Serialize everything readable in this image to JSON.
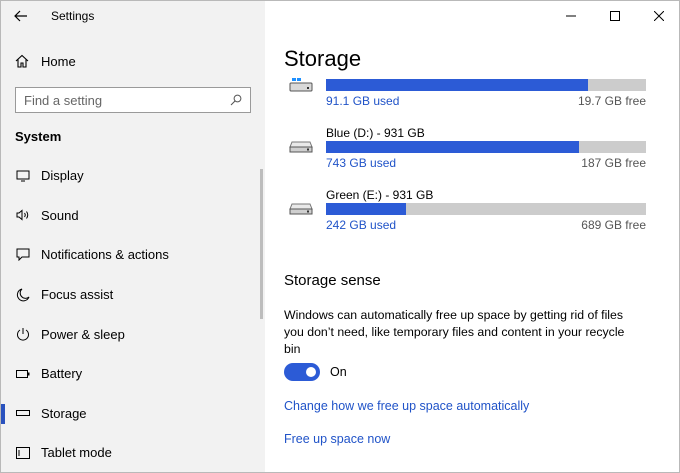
{
  "app": {
    "title": "Settings"
  },
  "sidebar": {
    "home_label": "Home",
    "search_placeholder": "Find a setting",
    "section_title": "System",
    "items": [
      {
        "label": "Display",
        "icon": "display-icon",
        "active": false
      },
      {
        "label": "Sound",
        "icon": "sound-icon",
        "active": false
      },
      {
        "label": "Notifications & actions",
        "icon": "notifications-icon",
        "active": false
      },
      {
        "label": "Focus assist",
        "icon": "moon-icon",
        "active": false
      },
      {
        "label": "Power & sleep",
        "icon": "power-icon",
        "active": false
      },
      {
        "label": "Battery",
        "icon": "battery-icon",
        "active": false
      },
      {
        "label": "Storage",
        "icon": "storage-icon",
        "active": true
      },
      {
        "label": "Tablet mode",
        "icon": "tablet-icon",
        "active": false
      }
    ]
  },
  "main": {
    "title": "Storage",
    "drives": [
      {
        "name": "",
        "used": "91.1 GB used",
        "free": "19.7 GB free",
        "fill": 0.82,
        "icon": "windows-drive-icon"
      },
      {
        "name": "Blue (D:) - 931 GB",
        "used": "743 GB used",
        "free": "187 GB free",
        "fill": 0.792,
        "icon": "drive-icon"
      },
      {
        "name": "Green (E:) - 931 GB",
        "used": "242 GB used",
        "free": "689 GB free",
        "fill": 0.25,
        "icon": "drive-icon"
      }
    ],
    "storage_sense": {
      "title": "Storage sense",
      "description": "Windows can automatically free up space by getting rid of files you don’t need, like temporary files and content in your recycle bin",
      "toggle_label": "On",
      "toggle_on": true,
      "link_change": "Change how we free up space automatically",
      "link_free": "Free up space now"
    }
  },
  "colors": {
    "accent": "#2c5bd6",
    "link": "#2053c8",
    "sidebar_bg": "#f2f2f2",
    "bar_track": "#cccccc"
  }
}
